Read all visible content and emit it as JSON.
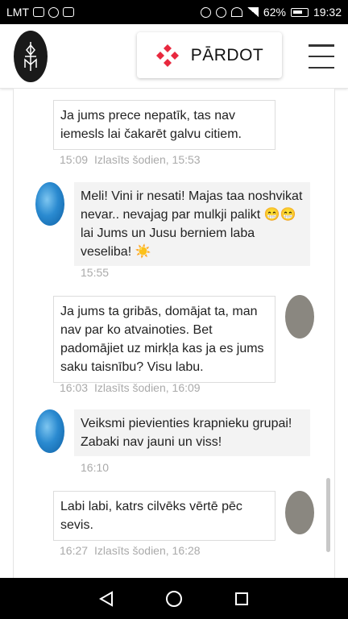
{
  "status_bar": {
    "carrier": "LMT",
    "battery_percent": "62%",
    "time": "19:32"
  },
  "header": {
    "sell_label": "PĀRDOT",
    "logo_icon": "brand-logo-icon",
    "menu_icon": "hamburger-menu-icon",
    "accent_color": "#e8283e"
  },
  "messages": [
    {
      "sender": "me",
      "text": "Ja jums prece nepatīk, tas nav iemesls lai čakarēt galvu citiem.",
      "time": "15:09",
      "read": "Izlasīts šodien, 15:53"
    },
    {
      "sender": "them",
      "text": "Meli! Vini ir nesati! Majas taa noshvikat nevar.. nevajag par mulkji palikt 😁😁 lai Jums un Jusu berniem laba veseliba! ☀️",
      "time": "15:55"
    },
    {
      "sender": "me",
      "text": "Ja jums ta gribās, domājat ta, man nav par ko atvainoties. Bet padomājiet uz mirkļa kas ja es jums saku taisnību? Visu labu.",
      "time": "16:03",
      "read": "Izlasīts šodien, 16:09"
    },
    {
      "sender": "them",
      "text": "Veiksmi pievienties krapnieku grupai! Zabaki nav jauni un viss!",
      "time": "16:10"
    },
    {
      "sender": "me",
      "text": "Labi labi, katrs cilvēks vērtē pēc sevis.",
      "time": "16:27",
      "read": "Izlasīts šodien, 16:28"
    }
  ],
  "nav_bar": {
    "back_icon": "back-triangle-icon",
    "home_icon": "home-circle-icon",
    "recents_icon": "recents-square-icon"
  }
}
